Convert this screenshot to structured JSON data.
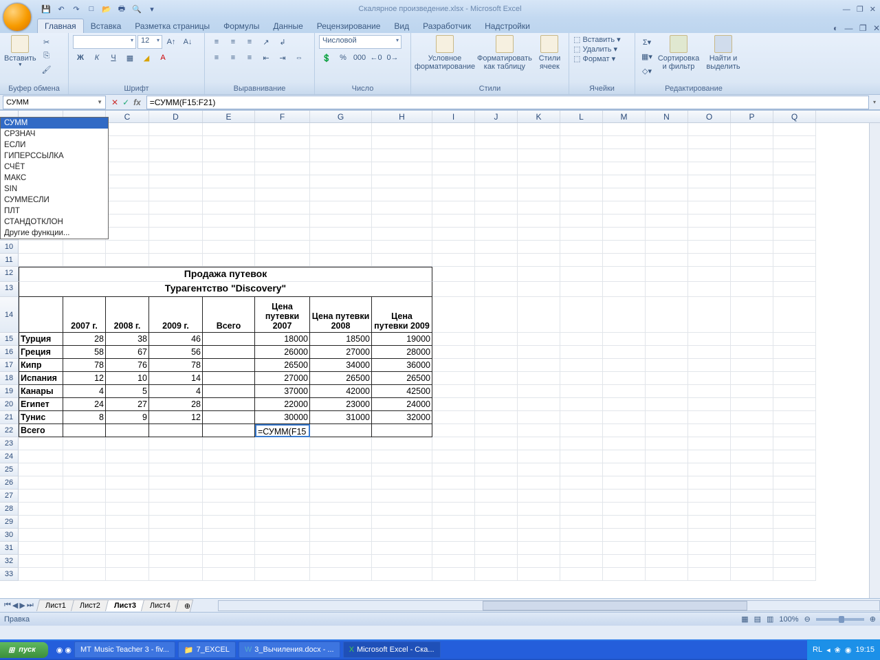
{
  "title": "Скалярное произведение.xlsx - Microsoft Excel",
  "qat": {
    "save": "💾",
    "undo": "↶",
    "redo": "↷",
    "new": "□",
    "open": "📂",
    "print": "🖶",
    "preview": "🔍",
    "more": "▾"
  },
  "win_btns": {
    "min": "—",
    "restore": "❐",
    "close": "✕"
  },
  "tabs": [
    "Главная",
    "Вставка",
    "Разметка страницы",
    "Формулы",
    "Данные",
    "Рецензирование",
    "Вид",
    "Разработчик",
    "Надстройки"
  ],
  "ribbon": {
    "clipboard": {
      "label": "Буфер обмена",
      "paste": "Вставить"
    },
    "font": {
      "label": "Шрифт",
      "name": "",
      "size": "12"
    },
    "align": {
      "label": "Выравнивание"
    },
    "number": {
      "label": "Число",
      "fmt": "Числовой"
    },
    "styles": {
      "label": "Стили",
      "cond": "Условное форматирование",
      "table": "Форматировать как таблицу",
      "cells": "Стили ячеек"
    },
    "cells_g": {
      "label": "Ячейки",
      "insert": "Вставить",
      "delete": "Удалить",
      "format": "Формат"
    },
    "editing": {
      "label": "Редактирование",
      "sort": "Сортировка и фильтр",
      "find": "Найти и выделить"
    }
  },
  "namebox": "СУММ",
  "formula": "=СУММ(F15:F21)",
  "func_list": [
    "СУММ",
    "СРЗНАЧ",
    "ЕСЛИ",
    "ГИПЕРССЫЛКА",
    "СЧЁТ",
    "МАКС",
    "SIN",
    "СУММЕСЛИ",
    "ПЛТ",
    "СТАНДОТКЛОН",
    "Другие функции..."
  ],
  "cols": [
    "C",
    "D",
    "E",
    "F",
    "G",
    "H",
    "I",
    "J",
    "K",
    "L",
    "M",
    "N",
    "O",
    "P",
    "Q"
  ],
  "sheet": {
    "title1": "Продажа путевок",
    "title2": "Турагентство \"Discovery\"",
    "head": {
      "y1": "2007 г.",
      "y2": "2008 г.",
      "y3": "2009 г.",
      "tot": "Всего",
      "p1": "Цена путевки 2007",
      "p2": "Цена путевки 2008",
      "p3": "Цена путевки 2009"
    },
    "rows": [
      {
        "n": "Турция",
        "a": "28",
        "b": "38",
        "c": "46",
        "p1": "18000",
        "p2": "18500",
        "p3": "19000"
      },
      {
        "n": "Греция",
        "a": "58",
        "b": "67",
        "c": "56",
        "p1": "26000",
        "p2": "27000",
        "p3": "28000"
      },
      {
        "n": "Кипр",
        "a": "78",
        "b": "76",
        "c": "78",
        "p1": "26500",
        "p2": "34000",
        "p3": "36000"
      },
      {
        "n": "Испания",
        "a": "12",
        "b": "10",
        "c": "14",
        "p1": "27000",
        "p2": "26500",
        "p3": "26500"
      },
      {
        "n": "Канары",
        "a": "4",
        "b": "5",
        "c": "4",
        "p1": "37000",
        "p2": "42000",
        "p3": "42500"
      },
      {
        "n": "Египет",
        "a": "24",
        "b": "27",
        "c": "28",
        "p1": "22000",
        "p2": "23000",
        "p3": "24000"
      },
      {
        "n": "Тунис",
        "a": "8",
        "b": "9",
        "c": "12",
        "p1": "30000",
        "p2": "31000",
        "p3": "32000"
      }
    ],
    "total_lbl": "Всего",
    "editing_cell": "=СУММ(F15"
  },
  "sheets": [
    "Лист1",
    "Лист2",
    "Лист3",
    "Лист4"
  ],
  "active_sheet": 2,
  "status": "Правка",
  "zoom": "100%",
  "lang": "RL",
  "taskbar": {
    "start": "пуск",
    "items": [
      "Music Teacher 3 - fiv...",
      "7_EXCEL",
      "3_Вычиления.docx - ...",
      "Microsoft Excel - Ска..."
    ],
    "time": "19:15"
  }
}
